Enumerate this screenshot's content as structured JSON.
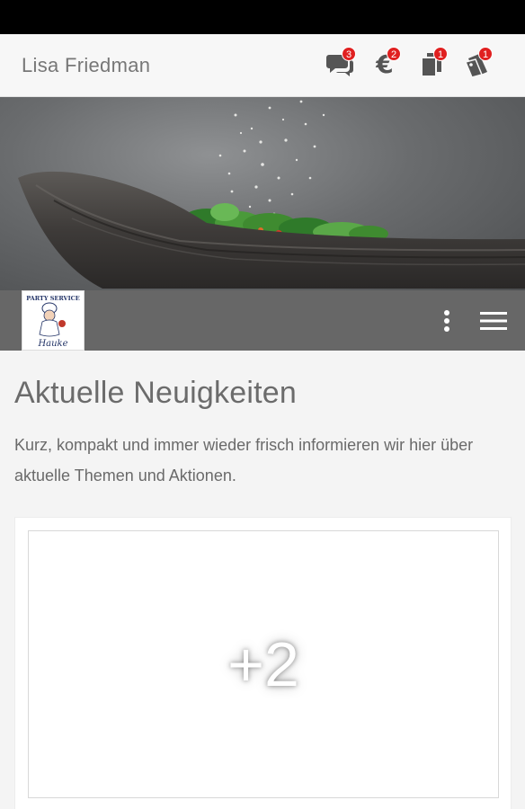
{
  "header": {
    "user_name": "Lisa Friedman",
    "icons": [
      {
        "name": "chat-icon",
        "badge": "3"
      },
      {
        "name": "euro-icon",
        "glyph": "€",
        "badge": "2"
      },
      {
        "name": "documents-icon",
        "badge": "1"
      },
      {
        "name": "coupons-icon",
        "badge": "1"
      }
    ]
  },
  "hero": {
    "image": "wooden-bowl-salad-photo"
  },
  "nav": {
    "logo": {
      "top_text": "PARTY SERVICE",
      "bottom_text": "Hauke"
    },
    "more_icon": "vertical-dots-icon",
    "menu_icon": "hamburger-menu-icon"
  },
  "content": {
    "title": "Aktuelle Neuigkeiten",
    "intro": "Kurz, kompakt und immer wieder frisch informieren wir hier über aktuelle Themen und Aktionen.",
    "card": {
      "more_label": "+2"
    }
  },
  "colors": {
    "badge": "#e02020",
    "nav_bar": "#676767",
    "text": "#6b6b6b"
  }
}
